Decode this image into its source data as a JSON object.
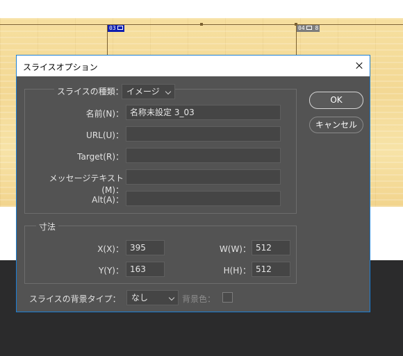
{
  "canvas": {
    "badges": [
      {
        "number": "03",
        "icon": "image-slice-icon",
        "color": "#0f1fb0"
      },
      {
        "number": "04",
        "icon": "image-slice-icon",
        "extra": "8",
        "color": "#7d7d7d"
      }
    ]
  },
  "dialog": {
    "title": "スライスオプション",
    "slice_type": {
      "label": "スライスの種類：",
      "value": "イメージ"
    },
    "fields": {
      "name": {
        "label": "名前(N)：",
        "value": "名称未設定 3_03"
      },
      "url": {
        "label": "URL(U)：",
        "value": ""
      },
      "target": {
        "label": "Target(R)：",
        "value": ""
      },
      "message": {
        "label": "メッセージテキスト(M)：",
        "value": ""
      },
      "alt": {
        "label": "Alt(A)：",
        "value": ""
      }
    },
    "dimensions": {
      "legend": "寸法",
      "x": {
        "label": "X(X)：",
        "value": "395"
      },
      "w": {
        "label": "W(W)：",
        "value": "512"
      },
      "y": {
        "label": "Y(Y)：",
        "value": "163"
      },
      "h": {
        "label": "H(H)：",
        "value": "512"
      }
    },
    "background": {
      "type_label": "スライスの背景タイプ：",
      "type_value": "なし",
      "color_label": "背景色："
    },
    "buttons": {
      "ok": "OK",
      "cancel": "キャンセル"
    }
  }
}
